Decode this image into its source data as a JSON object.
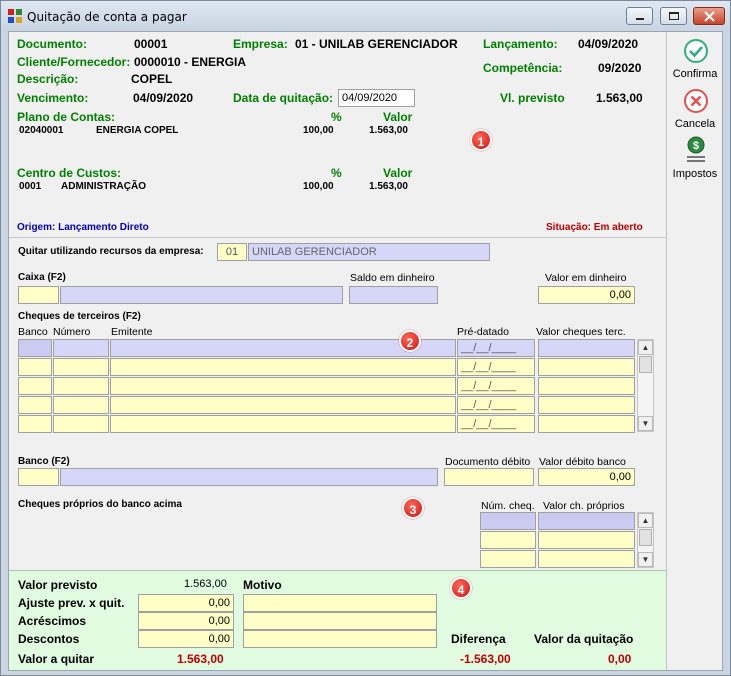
{
  "window": {
    "title": "Quitação de conta a pagar"
  },
  "header": {
    "documento_label": "Documento:",
    "documento": "00001",
    "empresa_label": "Empresa:",
    "empresa": "01 - UNILAB GERENCIADOR",
    "lancamento_label": "Lançamento:",
    "lancamento": "04/09/2020",
    "cliente_label": "Cliente/Fornecedor:",
    "cliente": "0000010 - ENERGIA",
    "competencia_label": "Competência:",
    "competencia": "09/2020",
    "descricao_label": "Descrição:",
    "descricao": "COPEL",
    "vencimento_label": "Vencimento:",
    "vencimento": "04/09/2020",
    "data_quitacao_label": "Data de quitação:",
    "data_quitacao": "04/09/2020",
    "vl_previsto_label": "Vl. previsto",
    "vl_previsto": "1.563,00"
  },
  "plano": {
    "title": "Plano de Contas:",
    "pct_header": "%",
    "valor_header": "Valor",
    "rows": [
      {
        "code": "02040001",
        "name": "ENERGIA COPEL",
        "pct": "100,00",
        "valor": "1.563,00"
      }
    ]
  },
  "centro": {
    "title": "Centro de Custos:",
    "pct_header": "%",
    "valor_header": "Valor",
    "rows": [
      {
        "code": "0001",
        "name": "ADMINISTRAÇÃO",
        "pct": "100,00",
        "valor": "1.563,00"
      }
    ]
  },
  "origem": "Origem: Lançamento Direto",
  "situacao": "Situação: Em aberto",
  "quitar": {
    "label": "Quitar utilizando recursos da empresa:",
    "code": "01",
    "name": "UNILAB GERENCIADOR"
  },
  "caixa": {
    "label": "Caixa (F2)",
    "saldo_label": "Saldo em dinheiro",
    "valor_label": "Valor em dinheiro",
    "valor": "0,00"
  },
  "cheques_terceiros": {
    "title": "Cheques de terceiros (F2)",
    "col_banco": "Banco",
    "col_numero": "Número",
    "col_emitente": "Emitente",
    "col_predatado": "Pré-datado",
    "col_valor": "Valor cheques terc.",
    "date_mask": "__/__/____"
  },
  "banco": {
    "label": "Banco (F2)",
    "doc_label": "Documento débito",
    "valor_label": "Valor débito banco",
    "valor": "0,00"
  },
  "cheques_proprios": {
    "title": "Cheques próprios do banco acima",
    "col_num": "Núm. cheq.",
    "col_valor": "Valor ch. próprios"
  },
  "resumo": {
    "valor_previsto_label": "Valor previsto",
    "valor_previsto": "1.563,00",
    "motivo_label": "Motivo",
    "ajuste_label": "Ajuste prev. x quit.",
    "ajuste": "0,00",
    "acrescimos_label": "Acréscimos",
    "acrescimos": "0,00",
    "descontos_label": "Descontos",
    "descontos": "0,00",
    "valor_quitar_label": "Valor a quitar",
    "valor_quitar": "1.563,00",
    "diferenca_label": "Diferença",
    "diferenca": "-1.563,00",
    "valor_quitacao_label": "Valor da quitação",
    "valor_quitacao": "0,00"
  },
  "actions": {
    "confirma": "Confirma",
    "cancela": "Cancela",
    "impostos": "Impostos"
  },
  "markers": [
    "1",
    "2",
    "3",
    "4"
  ]
}
